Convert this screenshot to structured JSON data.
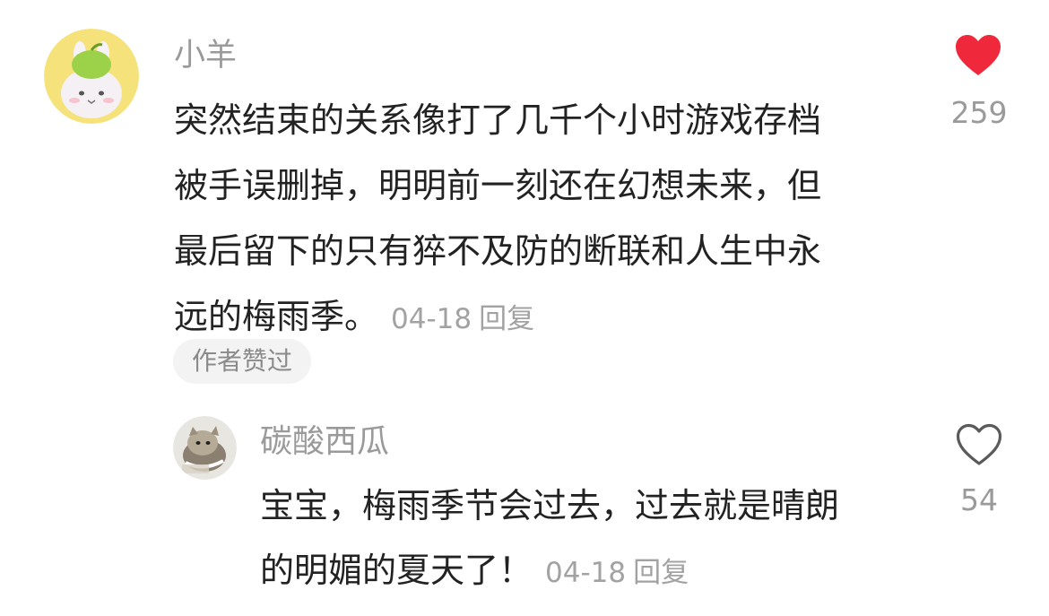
{
  "comments": [
    {
      "username": "小羊",
      "avatar_icon": "bunny-apple-avatar",
      "lines": [
        "突然结束的关系像打了几千个小时游戏存档",
        "被手误删掉，明明前一刻还在幻想未来，但",
        "最后留下的只有猝不及防的断联和人生中永",
        "远的梅雨季。"
      ],
      "date": "04-18",
      "reply_label": "回复",
      "badge": "作者赞过",
      "likes": "259",
      "liked": true,
      "like_color": "#f0283c"
    },
    {
      "username": "碳酸西瓜",
      "avatar_icon": "cat-photo-avatar",
      "lines": [
        "宝宝，梅雨季节会过去，过去就是晴朗",
        "的明媚的夏天了！"
      ],
      "date": "04-18",
      "reply_label": "回复",
      "likes": "54",
      "liked": false
    }
  ]
}
